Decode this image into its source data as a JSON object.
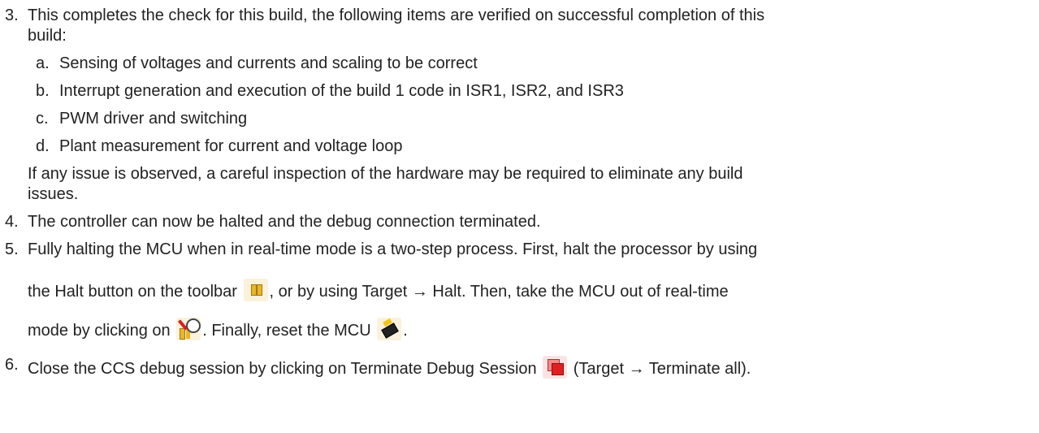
{
  "steps": [
    {
      "number": "3.",
      "lines": [
        "This completes the check for this build, the following items are verified on successful completion of this",
        "build:"
      ],
      "subitems": [
        {
          "letter": "a.",
          "text": "Sensing of voltages and currents and scaling to be correct"
        },
        {
          "letter": "b.",
          "text": "Interrupt generation and execution of the build 1 code in ISR1, ISR2, and ISR3"
        },
        {
          "letter": "c.",
          "text": "PWM driver and switching"
        },
        {
          "letter": "d.",
          "text": "Plant measurement for current and voltage loop"
        }
      ],
      "note_lines": [
        "If any issue is observed, a careful inspection of the hardware may be required to eliminate any build",
        "issues."
      ]
    },
    {
      "number": "4.",
      "text": "The controller can now be halted and the debug connection terminated."
    },
    {
      "number": "5.",
      "line1": "Fully halting the MCU when in real-time mode is a two-step process. First, halt the processor by using",
      "line2_before": "the Halt button on the toolbar",
      "line2_after": ", or by using Target → Halt. Then, take the MCU out of real-time",
      "line3_before": "mode by clicking on",
      "line3_middle": ". Finally, reset the MCU",
      "line3_end": "."
    },
    {
      "number": "6.",
      "text_before": "Close the CCS debug session by clicking on Terminate Debug Session",
      "text_after": "(Target → Terminate all)."
    }
  ],
  "icons": {
    "halt": "halt-icon",
    "realtime": "realtime-mode-icon",
    "reset": "reset-mcu-icon",
    "terminate": "terminate-debug-icon"
  }
}
